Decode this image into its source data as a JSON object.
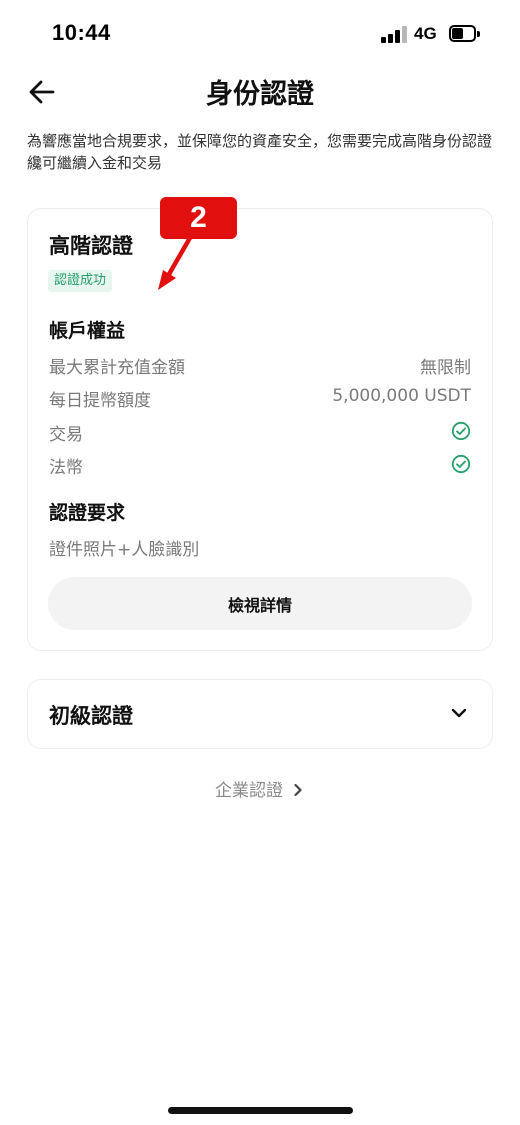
{
  "status_bar": {
    "time": "10:44",
    "network": "4G"
  },
  "header": {
    "title": "身份認證"
  },
  "intro_text": "為響應當地合規要求，並保障您的資產安全，您需要完成高階身份認證纔可繼續入金和交易",
  "annotation": {
    "label": "2",
    "color": "#e20f0f"
  },
  "advanced": {
    "title": "高階認證",
    "status": "認證成功",
    "benefits_heading": "帳戶權益",
    "rows": [
      {
        "label": "最大累計充值金額",
        "value": "無限制"
      },
      {
        "label": "每日提幣額度",
        "value": "5,000,000 USDT"
      },
      {
        "label": "交易",
        "icon": "check-circle-icon"
      },
      {
        "label": "法幣",
        "icon": "check-circle-icon"
      }
    ],
    "requirements_heading": "認證要求",
    "requirements": "證件照片+人臉識別",
    "details_button": "檢視詳情"
  },
  "basic": {
    "title": "初級認證"
  },
  "enterprise_link": "企業認證",
  "colors": {
    "success": "#26a069",
    "success_bg": "#e7f6ee",
    "muted_text": "#7a7a7a",
    "button_bg": "#f3f3f3"
  }
}
